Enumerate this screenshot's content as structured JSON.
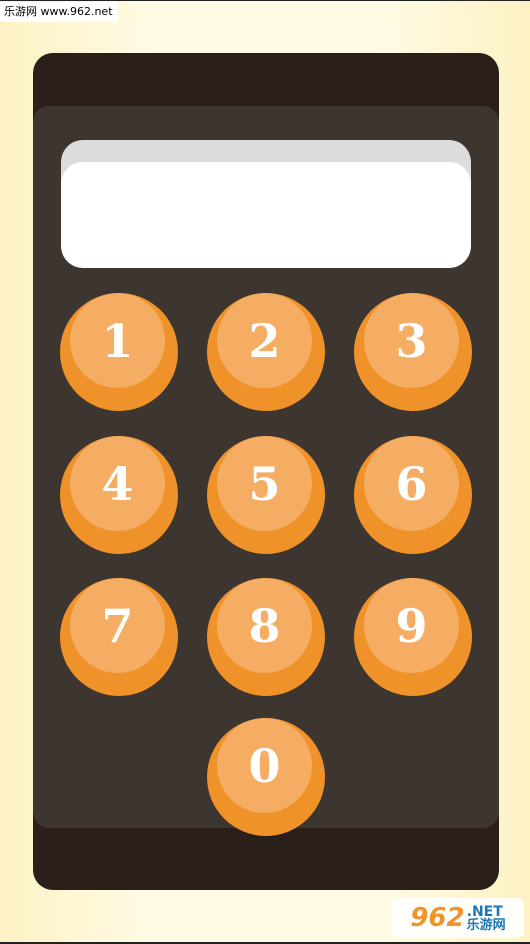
{
  "watermark": {
    "site_label": "乐游网 www.962.net"
  },
  "display": {
    "value": ""
  },
  "keypad": {
    "keys": [
      "1",
      "2",
      "3",
      "4",
      "5",
      "6",
      "7",
      "8",
      "9",
      "0"
    ]
  },
  "logo": {
    "number": "962",
    "net": ".NET",
    "cn": "乐游网"
  },
  "colors": {
    "key_outer": "#f0922a",
    "key_face": "#f4ad63",
    "device_body": "#2a1f1b",
    "device_panel": "#3d3530",
    "screen": "#ffffff"
  }
}
